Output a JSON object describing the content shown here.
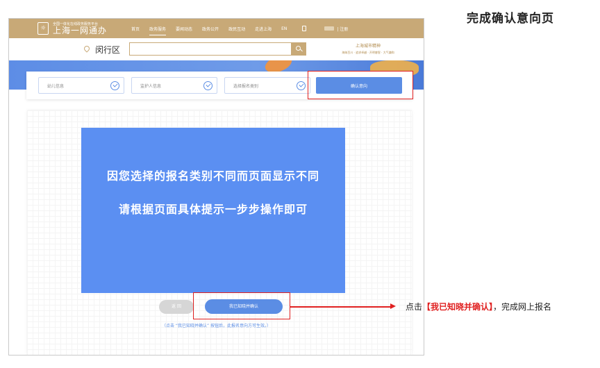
{
  "heading": "完成确认意向页",
  "header": {
    "logo_subtitle": "全国一体化在线政务服务平台",
    "logo_title": "上海一网通办",
    "nav": [
      "首页",
      "政务服务",
      "要闻动态",
      "政务公开",
      "政民互动",
      "走进上海",
      "EN"
    ],
    "register": "| 注册"
  },
  "search": {
    "district": "闵行区",
    "placeholder": "",
    "brand_title": "上海城市精神",
    "brand_sub": "海纳百川 · 追求卓越 · 开明睿智 · 大气谦和"
  },
  "steps": [
    {
      "label": "幼儿信息",
      "done": true
    },
    {
      "label": "监护人信息",
      "done": true
    },
    {
      "label": "选择报名类别",
      "done": true
    },
    {
      "label": "确认意向",
      "done": false
    }
  ],
  "notice": {
    "line1": "因您选择的报名类别不同而页面显示不同",
    "line2": "请根据页面具体提示一步步操作即可"
  },
  "buttons": {
    "back": "返 回",
    "confirm": "我已知晓并确认"
  },
  "hint": "（点击 “我已知晓并确认” 按钮后，此报名意向方可生效。）",
  "annotation": {
    "prefix": "点击",
    "emphasis": "【我已知晓并确认】",
    "suffix": "，完成网上报名"
  },
  "colors": {
    "header_gold": "#c8a977",
    "primary_blue": "#5b8de4",
    "annotation_red": "#e02020"
  }
}
